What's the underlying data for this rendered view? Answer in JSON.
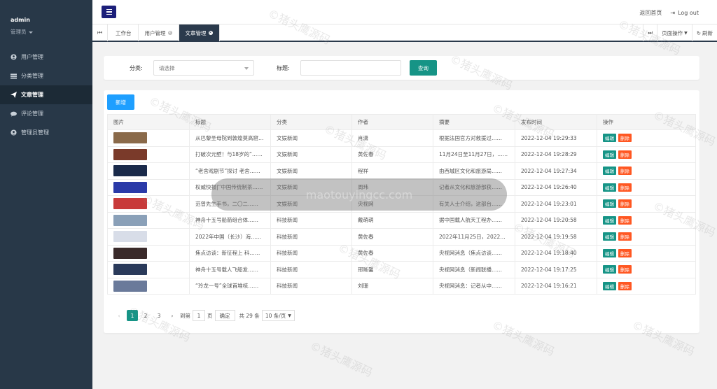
{
  "sidebar": {
    "username": "admin",
    "role": "管理员",
    "items": [
      {
        "label": "用户管理",
        "icon": "user-icon"
      },
      {
        "label": "分类管理",
        "icon": "list-icon"
      },
      {
        "label": "文章管理",
        "icon": "send-icon"
      },
      {
        "label": "评论管理",
        "icon": "comment-icon"
      },
      {
        "label": "管理员管理",
        "icon": "user-circle-icon"
      }
    ]
  },
  "header": {
    "home_link": "返回首页",
    "logout": "Log out"
  },
  "tabs": {
    "items": [
      {
        "label": "工作台"
      },
      {
        "label": "用户管理"
      },
      {
        "label": "文章管理"
      }
    ],
    "page_ops": "页面操作",
    "refresh": "刷新"
  },
  "search": {
    "category_label": "分类:",
    "category_placeholder": "请选择",
    "title_label": "标题:",
    "search_button": "查询"
  },
  "table": {
    "add_button": "新增",
    "columns": [
      "图片",
      "标题",
      "分类",
      "作者",
      "摘要",
      "发布时间",
      "操作"
    ],
    "edit_label": "编辑",
    "delete_label": "删除",
    "rows": [
      {
        "title": "从巴黎圣母院到敦煌莫高窟……",
        "category": "文娱新闻",
        "author": "肖潇",
        "summary": "根据法国官方对救援过……",
        "time": "2022-12-04 19:29:33",
        "thumb": "#8a6a4a"
      },
      {
        "title": "打破次元壁！与18岁的“……",
        "category": "文娱新闻",
        "author": "黄佐春",
        "summary": "11月24日至11月27日，……",
        "time": "2022-12-04 19:28:29",
        "thumb": "#7a3a2a"
      },
      {
        "title": "“老舍戏剧节”探讨 老舍……",
        "category": "文娱新闻",
        "author": "程祥",
        "summary": "由西城区文化和旅游局……",
        "time": "2022-12-04 19:27:34",
        "thumb": "#1a2a4a"
      },
      {
        "title": "权威快报|“中国传统制茶……",
        "category": "文娱新闻",
        "author": "周玮",
        "summary": "记者从文化和旅游部获……",
        "time": "2022-12-04 19:26:40",
        "thumb": "#2a3aa8"
      },
      {
        "title": "范曾先生手书，二〇二……",
        "category": "文娱新闻",
        "author": "央视网",
        "summary": "有关人士介绍，这部台……",
        "time": "2022-12-04 19:23:01",
        "thumb": "#c83a3a"
      },
      {
        "title": "神舟十五号船箭组合体……",
        "category": "科技新闻",
        "author": "戴萌萌",
        "summary": "据中国载人航天工程办……",
        "time": "2022-12-04 19:20:58",
        "thumb": "#8aa0b8"
      },
      {
        "title": "2022年中国（长沙）海……",
        "category": "科技新闻",
        "author": "黄佐春",
        "summary": "2022年11月25日，2022……",
        "time": "2022-12-04 19:19:58",
        "thumb": "#d8dde8"
      },
      {
        "title": "焦点访谈：新征程上 科……",
        "category": "科技新闻",
        "author": "黄佐春",
        "summary": "央视网消息（焦点访谈……",
        "time": "2022-12-04 19:18:40",
        "thumb": "#3a2a2a"
      },
      {
        "title": "神舟十五号载人飞船发……",
        "category": "科技新闻",
        "author": "邢晰馨",
        "summary": "央视网消息（新闻联播……",
        "time": "2022-12-04 19:17:25",
        "thumb": "#2a3a5a"
      },
      {
        "title": "“玲龙一号”全球首堆核……",
        "category": "科技新闻",
        "author": "刘珊",
        "summary": "央视网消息：记者从中……",
        "time": "2022-12-04 19:16:21",
        "thumb": "#6a7a9a"
      }
    ]
  },
  "pager": {
    "pages": [
      "1",
      "2",
      "3"
    ],
    "goto_label": "到第",
    "goto_value": "1",
    "page_unit": "页",
    "confirm": "确定",
    "total": "共 29 条",
    "per_page": "10 条/页"
  },
  "watermark": {
    "text": "©猪头鹰源码",
    "domain": "maotouyingcc.com"
  }
}
